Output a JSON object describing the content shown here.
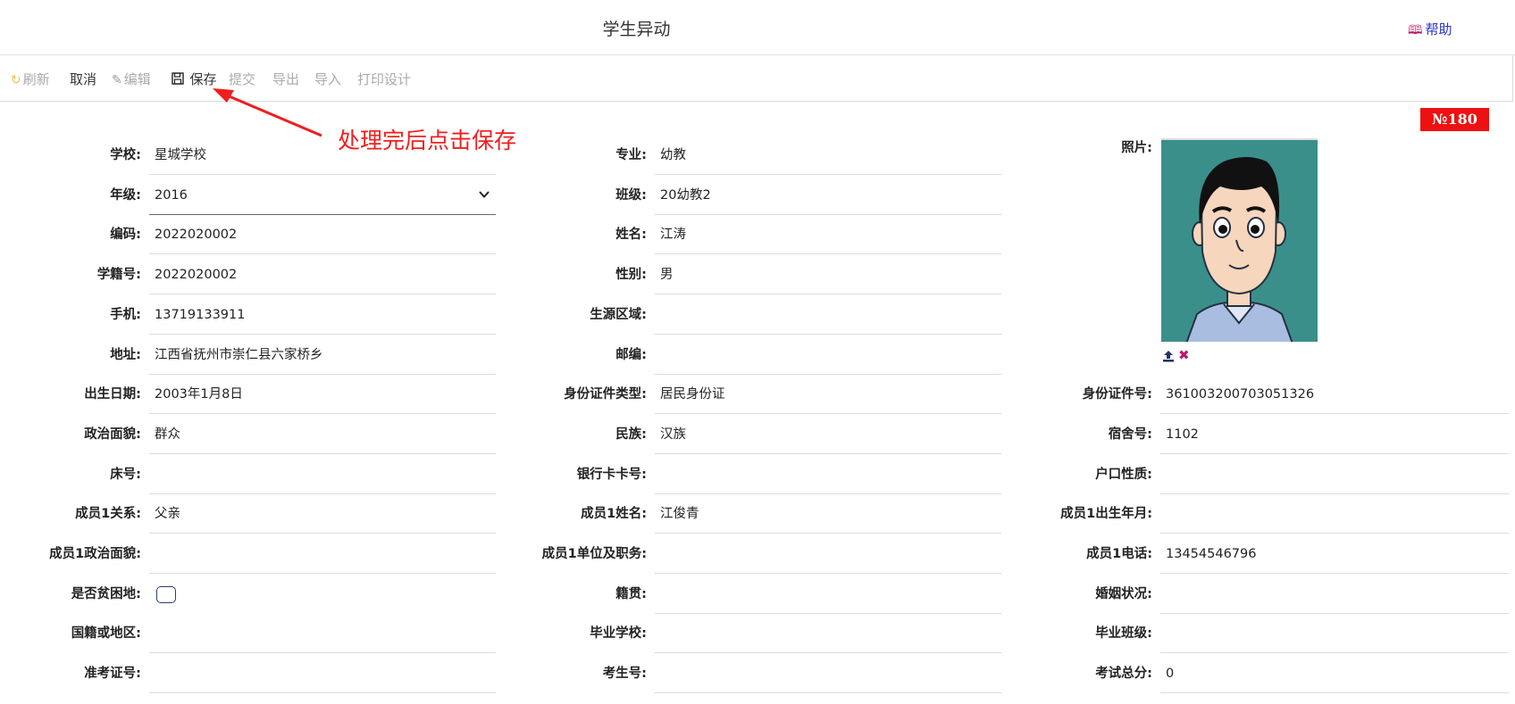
{
  "header": {
    "title": "学生异动",
    "help_label": "帮助"
  },
  "toolbar": {
    "refresh": "刷新",
    "cancel": "取消",
    "edit": "编辑",
    "save": "保存",
    "submit": "提交",
    "export": "导出",
    "import": "导入",
    "print_design": "打印设计"
  },
  "annotation": {
    "text": "处理完后点击保存",
    "color": "#f01e1e"
  },
  "badge": {
    "text": "№180",
    "color": "#ee1111"
  },
  "photo": {
    "label": "照片:"
  },
  "form": {
    "col1": [
      {
        "label": "学校:",
        "value": "星城学校"
      },
      {
        "label": "年级:",
        "value": "2016"
      },
      {
        "label": "编码:",
        "value": "2022020002"
      },
      {
        "label": "学籍号:",
        "value": "2022020002"
      },
      {
        "label": "手机:",
        "value": "13719133911"
      },
      {
        "label": "地址:",
        "value": "江西省抚州市崇仁县六家桥乡"
      },
      {
        "label": "出生日期:",
        "value": "2003年1月8日"
      },
      {
        "label": "政治面貌:",
        "value": "群众"
      },
      {
        "label": "床号:",
        "value": ""
      },
      {
        "label": "成员1关系:",
        "value": "父亲"
      },
      {
        "label": "成员1政治面貌:",
        "value": ""
      },
      {
        "label": "是否贫困地:",
        "value": "",
        "checked": false
      },
      {
        "label": "国籍或地区:",
        "value": ""
      },
      {
        "label": "准考证号:",
        "value": ""
      }
    ],
    "col2": [
      {
        "label": "专业:",
        "value": "幼教"
      },
      {
        "label": "班级:",
        "value": "20幼教2"
      },
      {
        "label": "姓名:",
        "value": "江涛"
      },
      {
        "label": "性别:",
        "value": "男"
      },
      {
        "label": "生源区域:",
        "value": ""
      },
      {
        "label": "邮编:",
        "value": ""
      },
      {
        "label": "身份证件类型:",
        "value": "居民身份证"
      },
      {
        "label": "民族:",
        "value": "汉族"
      },
      {
        "label": "银行卡卡号:",
        "value": ""
      },
      {
        "label": "成员1姓名:",
        "value": "江俊青"
      },
      {
        "label": "成员1单位及职务:",
        "value": ""
      },
      {
        "label": "籍贯:",
        "value": ""
      },
      {
        "label": "毕业学校:",
        "value": ""
      },
      {
        "label": "考生号:",
        "value": ""
      }
    ],
    "col3": [
      {
        "label": "身份证件号:",
        "value": "361003200703051326"
      },
      {
        "label": "宿舍号:",
        "value": "1102"
      },
      {
        "label": "户口性质:",
        "value": ""
      },
      {
        "label": "成员1出生年月:",
        "value": ""
      },
      {
        "label": "成员1电话:",
        "value": "13454546796"
      },
      {
        "label": "婚姻状况:",
        "value": ""
      },
      {
        "label": "毕业班级:",
        "value": ""
      },
      {
        "label": "考试总分:",
        "value": "0"
      }
    ]
  }
}
